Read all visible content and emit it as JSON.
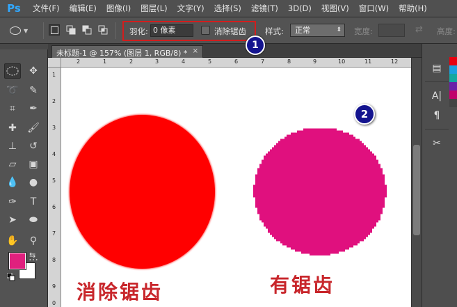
{
  "app": {
    "logo": "Ps"
  },
  "menu": [
    "文件(F)",
    "编辑(E)",
    "图像(I)",
    "图层(L)",
    "文字(Y)",
    "选择(S)",
    "滤镜(T)",
    "3D(D)",
    "视图(V)",
    "窗口(W)",
    "帮助(H)"
  ],
  "options": {
    "feather_label": "羽化:",
    "feather_value": "0 像素",
    "antialias_label": "消除锯齿",
    "antialias_checked": false,
    "style_label": "样式:",
    "style_value": "正常",
    "width_label": "宽度:",
    "height_label": "高度:"
  },
  "document": {
    "tab_title": "未标题-1 @ 157% (图层 1, RGB/8) *",
    "tab_close": "×"
  },
  "rulers": {
    "top_ticks": [
      "2",
      "1",
      "2",
      "3",
      "4",
      "5",
      "6",
      "7",
      "8",
      "9",
      "10",
      "11",
      "12"
    ],
    "left_ticks": [
      "1",
      "2",
      "3",
      "4",
      "5",
      "6",
      "7",
      "8",
      "9",
      "0"
    ]
  },
  "canvas": {
    "caption_left": "消除锯齿",
    "caption_right": "有锯齿",
    "circle_left_color": "#ff0000",
    "circle_right_color": "#e0107e",
    "caption_color": "#c8262b"
  },
  "annotations": {
    "badge1": "1",
    "badge2": "2"
  },
  "colors": {
    "foreground": "#e0207e",
    "background": "#ffffff",
    "accent_red_box": "#d21d1d"
  },
  "swatches": [
    "#e8000f",
    "#1aa0e0",
    "#12a8a0",
    "#6a22a8",
    "#c0006a",
    "#444444"
  ]
}
